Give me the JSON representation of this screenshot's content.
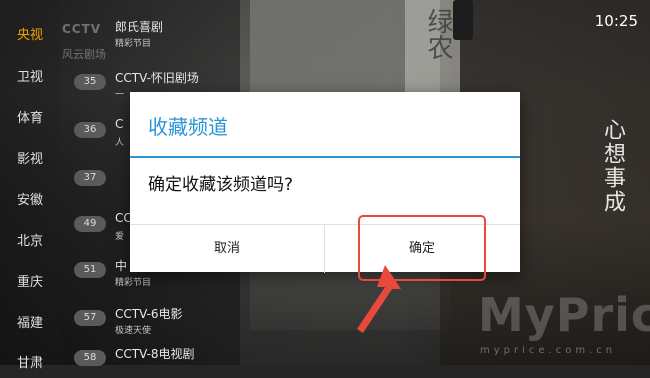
{
  "status_bar": {
    "clock": "10:25"
  },
  "background": {
    "sign_text": "绿农",
    "calligraphy": "心想事成"
  },
  "sidebar": {
    "categories": [
      {
        "label": "央视",
        "active": true
      },
      {
        "label": "卫视",
        "active": false
      },
      {
        "label": "体育",
        "active": false
      },
      {
        "label": "影视",
        "active": false
      },
      {
        "label": "安徽",
        "active": false
      },
      {
        "label": "北京",
        "active": false
      },
      {
        "label": "重庆",
        "active": false
      },
      {
        "label": "福建",
        "active": false
      },
      {
        "label": "甘肃",
        "active": false
      }
    ]
  },
  "channel_list": {
    "logo": "CCTV",
    "logo_sub": "风云剧场",
    "channels": [
      {
        "number": "",
        "name": "郎氏喜剧",
        "program": "精彩节目"
      },
      {
        "number": "35",
        "name": "CCTV-怀旧剧场",
        "program": "一"
      },
      {
        "number": "36",
        "name": "C",
        "program": "人"
      },
      {
        "number": "37",
        "name": "",
        "program": ""
      },
      {
        "number": "49",
        "name": "CCTV",
        "program": "爱"
      },
      {
        "number": "51",
        "name": "中",
        "program": "精彩节目"
      },
      {
        "number": "57",
        "name": "CCTV-6电影",
        "program": "极速天使"
      },
      {
        "number": "58",
        "name": "CCTV-8电视剧",
        "program": ""
      }
    ]
  },
  "dialog": {
    "title": "收藏频道",
    "message": "确定收藏该频道吗?",
    "cancel_label": "取消",
    "ok_label": "确定",
    "accent_color": "#2b95d6"
  },
  "annotation": {
    "highlight_color": "#e8493c"
  },
  "watermark": {
    "text": "MyPrice",
    "subtext": "myprice.com.cn"
  }
}
